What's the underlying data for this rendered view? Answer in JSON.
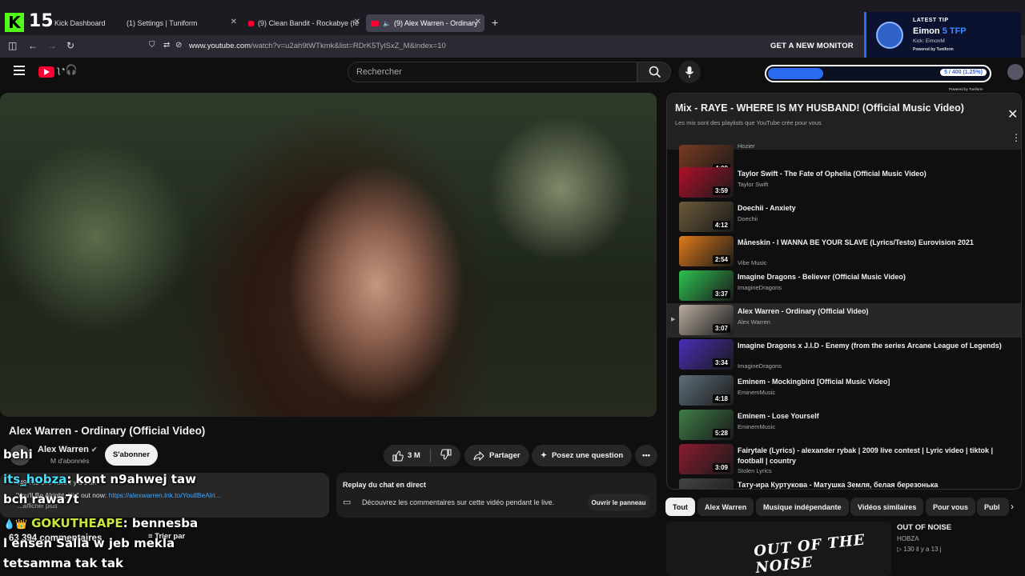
{
  "browser": {
    "kick_count": "15",
    "tabs": [
      {
        "title": "Kick Dashboard"
      },
      {
        "title": "(1) Settings | Tuniform"
      },
      {
        "title": "(9) Clean Bandit - Rockabye (fe"
      },
      {
        "title": "(9) Alex Warren - Ordinary"
      }
    ],
    "url_host": "www.youtube.com",
    "url_path": "/watch?v=u2ah9tWTkmk&list=RDrK5TylSxZ_M&index=10",
    "monitor_button": "GET A NEW MONITOR"
  },
  "tip_overlay": {
    "label": "LATEST TIP",
    "name": "Eimon",
    "amount": "5 TFP",
    "kick": "Kick: EimonM",
    "powered": "Powered by Tuniform"
  },
  "goal_bar": {
    "text": "5 / 400 (1.25%)",
    "fraction": 0.0125,
    "powered": "Powered by Tuniform"
  },
  "header": {
    "search_placeholder": "Rechercher"
  },
  "video": {
    "title": "Alex Warren - Ordinary (Official Video)",
    "channel": "Alex Warren",
    "subscribers": "M d'abonnés",
    "subscribe_label": "S'abonner",
    "likes": "3 M",
    "share_label": "Partager",
    "ask_label": "Posez une question",
    "desc_stats": "449 752 073 vues  il y a 1 an",
    "desc_link_prefix": "'You'll Be Alright, Kid' out now:",
    "desc_link": "https://alexwarren.lnk.to/YoullBeAlri...",
    "desc_more": "...afficher plus",
    "comments_count": "63 394 commentaires",
    "sort_label": "Trier par"
  },
  "replay": {
    "title": "Replay du chat en direct",
    "text": "Découvrez les commentaires sur cette vidéo pendant le live.",
    "button": "Ouvrir le panneau"
  },
  "chat": [
    {
      "user": "",
      "msg": "behi"
    },
    {
      "user": "its_hobza",
      "msg": ": kont n9ahwej taw"
    },
    {
      "user": "",
      "msg": "bch rawa7t"
    },
    {
      "user": "GOKUTHEAPE",
      "msg": ": bennesba"
    },
    {
      "user": "",
      "msg": "l ensen Salla w jeb mekla"
    },
    {
      "user": "",
      "msg": "tetsamma tak tak"
    }
  ],
  "playlist": {
    "title": "Mix - RAYE - WHERE IS MY HUSBAND! (Official Music Video)",
    "subtitle": "Les mix sont des playlists que YouTube crée pour vous",
    "items": [
      {
        "title": "",
        "channel": "Hozier",
        "duration": "4:09"
      },
      {
        "title": "Taylor Swift - The Fate of Ophelia (Official Music Video)",
        "channel": "Taylor Swift",
        "duration": "3:59"
      },
      {
        "title": "Doechii - Anxiety",
        "channel": "Doechii",
        "duration": "4:12"
      },
      {
        "title": "Måneskin - I WANNA BE YOUR SLAVE (Lyrics/Testo) Eurovision 2021",
        "channel": "Vibe Music",
        "duration": "2:54"
      },
      {
        "title": "Imagine Dragons - Believer (Official Music Video)",
        "channel": "ImagineDragons",
        "duration": "3:37"
      },
      {
        "title": "Alex Warren - Ordinary (Official Video)",
        "channel": "Alex Warren",
        "duration": "3:07"
      },
      {
        "title": "Imagine Dragons x J.I.D - Enemy (from the series Arcane League of Legends)",
        "channel": "ImagineDragons",
        "duration": "3:34"
      },
      {
        "title": "Eminem - Mockingbird [Official Music Video]",
        "channel": "EminemMusic",
        "duration": "4:18"
      },
      {
        "title": "Eminem - Lose Yourself",
        "channel": "EminemMusic",
        "duration": "5:28"
      },
      {
        "title": "Fairytale (Lyrics) - alexander rybak | 2009 live contest | Lyric video | tiktok | football | country",
        "channel": "Stolen Lyrics",
        "duration": "3:09"
      },
      {
        "title": "Тату-ира Куртукова - Матушка Земля, белая березонька",
        "channel": "",
        "duration": ""
      }
    ]
  },
  "chips": [
    "Tout",
    "Alex Warren",
    "Musique indépendante",
    "Vidéos similaires",
    "Pour vous",
    "Publ"
  ],
  "recommended": {
    "thumb_text": "OUT OF THE NOISE",
    "title": "OUT OF NOISE",
    "channel": "HOBZA",
    "meta": "▷ 130  il y a 13 j"
  }
}
